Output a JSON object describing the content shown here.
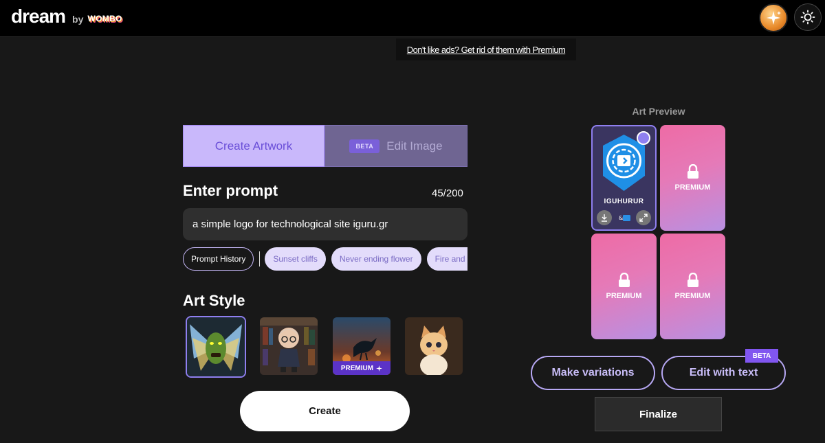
{
  "header": {
    "logo_main": "dream",
    "logo_by": "by",
    "logo_brand": "WOMBO",
    "avatar_icon": "sparkle-avatar-icon",
    "theme_icon": "sun-icon"
  },
  "ad": {
    "text": "Don't like ads? Get rid of them with Premium"
  },
  "tabs": {
    "create_label": "Create Artwork",
    "edit_badge": "BETA",
    "edit_label": "Edit Image"
  },
  "prompt": {
    "title": "Enter prompt",
    "count": "45/200",
    "value": "a simple logo for technological site iguru.gr"
  },
  "chips": {
    "history": "Prompt History",
    "suggestions": [
      "Sunset cliffs",
      "Never ending flower",
      "Fire and water"
    ]
  },
  "art_style": {
    "title": "Art Style",
    "premium_label": "PREMIUM"
  },
  "create_button": "Create",
  "preview": {
    "title": "Art Preview",
    "logo_caption": "IGUHURUR",
    "premium_label": "PREMIUM"
  },
  "actions": {
    "variations": "Make variations",
    "edit_text": "Edit with text",
    "edit_text_badge": "BETA",
    "finalize": "Finalize"
  },
  "colors": {
    "accent": "#8f7ff0",
    "tab_active_bg": "#c9b8fb",
    "premium_gradient_start": "#ee6ba5",
    "premium_gradient_end": "#b890e2"
  }
}
